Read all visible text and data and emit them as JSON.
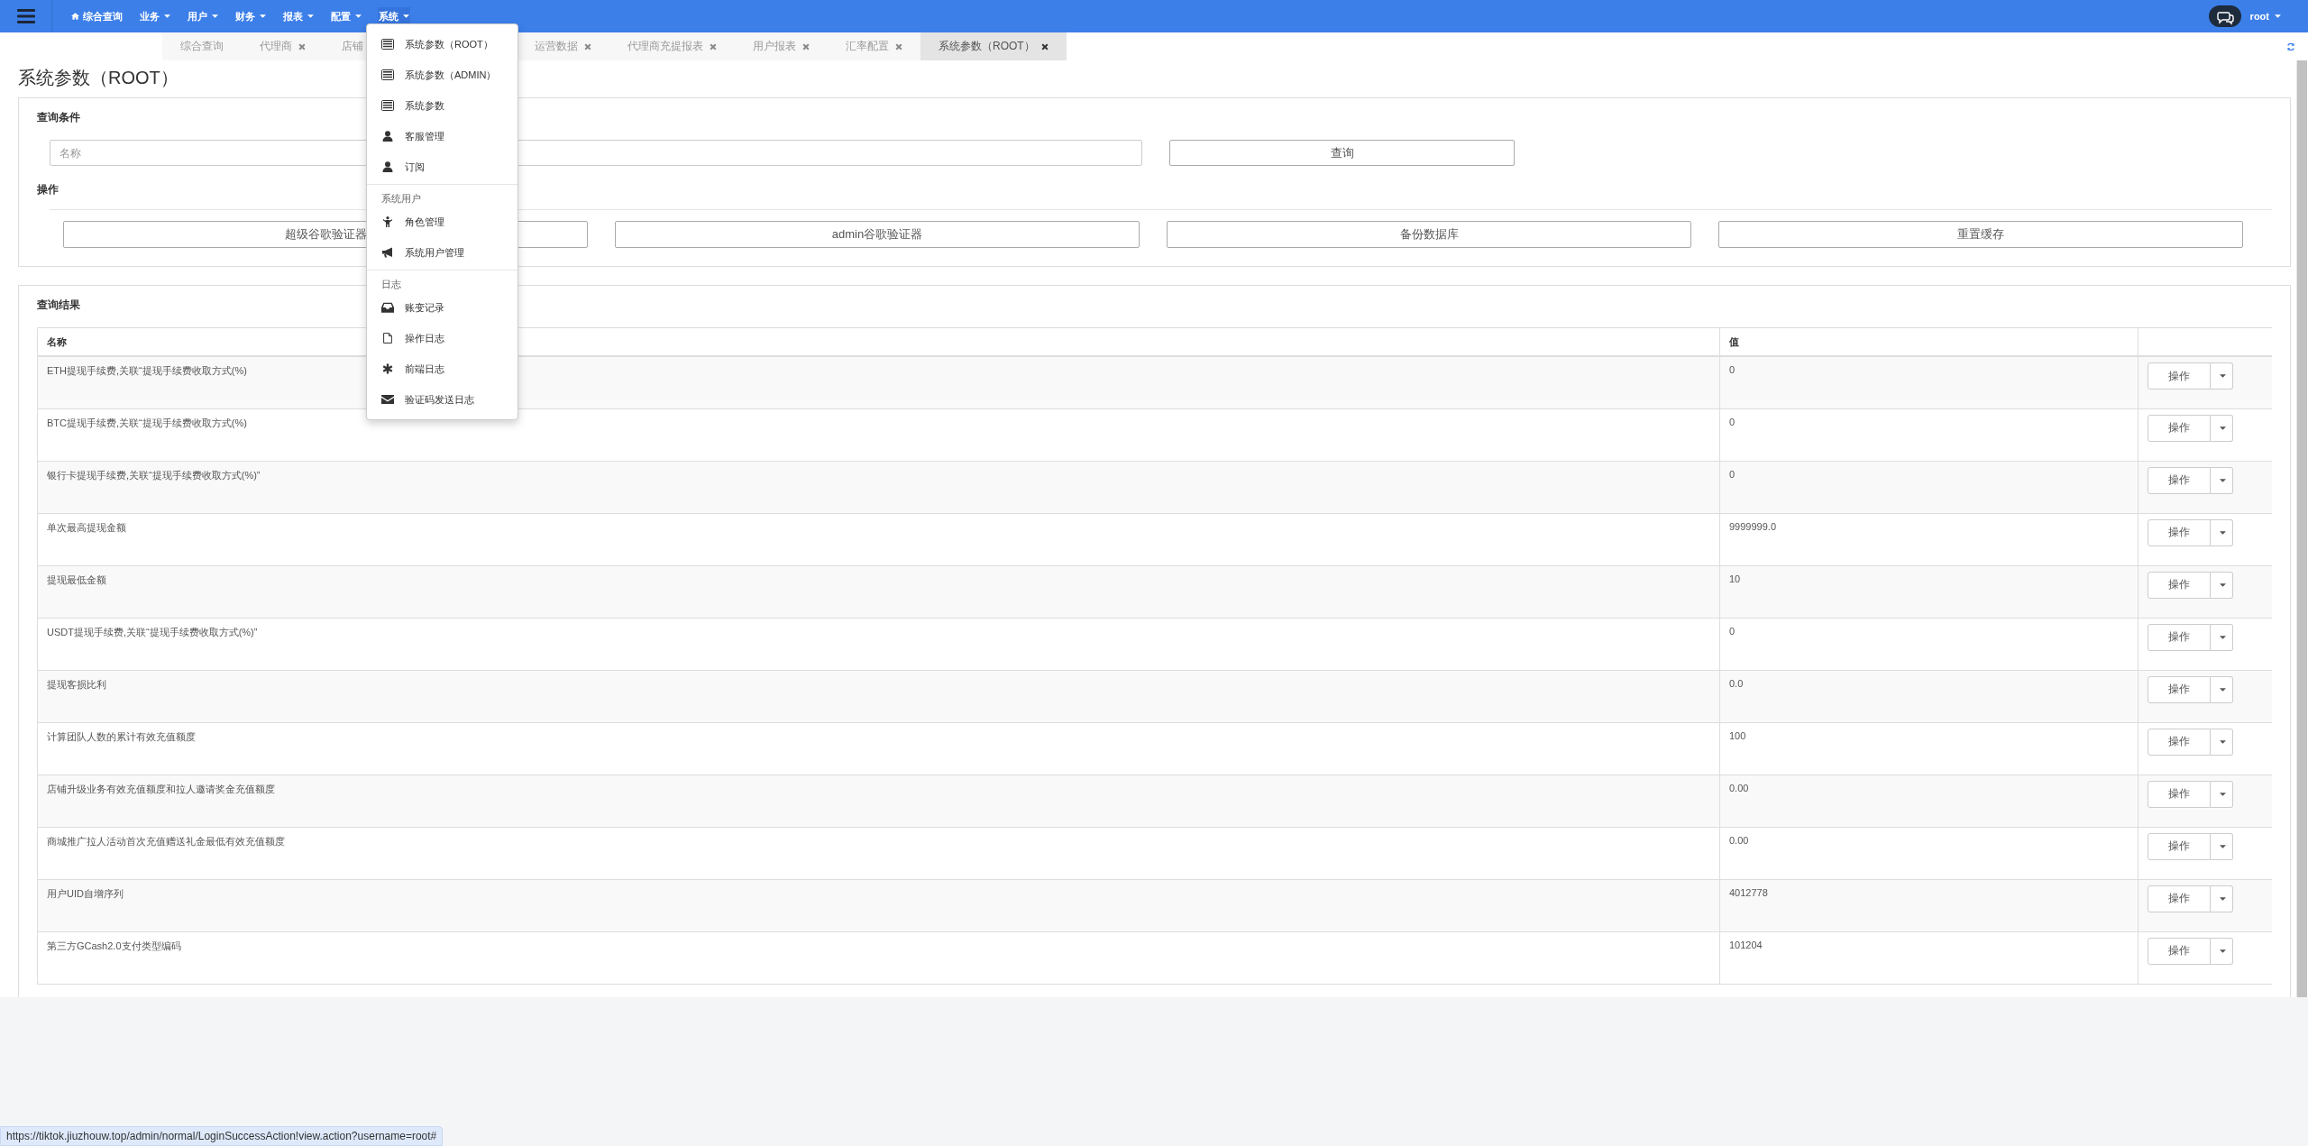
{
  "navbar": {
    "items": [
      {
        "kind": "home",
        "label": "综合查询",
        "open": false
      },
      {
        "kind": "dropdown",
        "label": "业务",
        "open": false
      },
      {
        "kind": "dropdown",
        "label": "用户",
        "open": false
      },
      {
        "kind": "dropdown",
        "label": "财务",
        "open": false
      },
      {
        "kind": "dropdown",
        "label": "报表",
        "open": false
      },
      {
        "kind": "dropdown",
        "label": "配置",
        "open": false
      },
      {
        "kind": "dropdown",
        "label": "系统",
        "open": true
      }
    ],
    "user": "root"
  },
  "tabs": [
    {
      "label": "综合查询",
      "closable": false,
      "selected": false
    },
    {
      "label": "代理商",
      "closable": true,
      "selected": false
    },
    {
      "label": "店铺",
      "closable": false,
      "selected": false
    },
    {
      "label": "运营数据",
      "closable": true,
      "selected": false
    },
    {
      "label": "代理商充提报表",
      "closable": true,
      "selected": false
    },
    {
      "label": "用户报表",
      "closable": true,
      "selected": false
    },
    {
      "label": "汇率配置",
      "closable": true,
      "selected": false
    },
    {
      "label": "系统参数（ROOT）",
      "closable": true,
      "selected": true
    }
  ],
  "page_title": "系统参数（ROOT）",
  "query_panel": {
    "title": "查询条件",
    "name_field": {
      "placeholder": "名称"
    },
    "search_button": "查询",
    "actions_title": "操作",
    "action_buttons": [
      "超级谷歌验证器",
      "admin谷歌验证器",
      "备份数据库",
      "重置缓存"
    ]
  },
  "results_panel": {
    "title": "查询结果",
    "columns": [
      "名称",
      "值"
    ],
    "rows": [
      {
        "name": "ETH提现手续费,关联“提现手续费收取方式(%)",
        "value": "0",
        "action": "操作"
      },
      {
        "name": "BTC提现手续费,关联“提现手续费收取方式(%)",
        "value": "0",
        "action": "操作"
      },
      {
        "name": "银行卡提现手续费,关联“提现手续费收取方式(%)”",
        "value": "0",
        "action": "操作"
      },
      {
        "name": "单次最高提现金额",
        "value": "9999999.0",
        "action": "操作"
      },
      {
        "name": "提现最低金额",
        "value": "10",
        "action": "操作"
      },
      {
        "name": "USDT提现手续费,关联“提现手续费收取方式(%)”",
        "value": "0",
        "action": "操作"
      },
      {
        "name": "提现客损比利",
        "value": "0.0",
        "action": "操作"
      },
      {
        "name": "计算团队人数的累计有效充值额度",
        "value": "100",
        "action": "操作"
      },
      {
        "name": "店铺升级业务有效充值额度和拉人邀请奖金充值额度",
        "value": "0.00",
        "action": "操作"
      },
      {
        "name": "商城推广拉人活动首次充值赠送礼金最低有效充值额度",
        "value": "0.00",
        "action": "操作"
      },
      {
        "name": "用户UID自增序列",
        "value": "4012778",
        "action": "操作"
      },
      {
        "name": "第三方GCash2.0支付类型编码",
        "value": "101204",
        "action": "操作"
      }
    ]
  },
  "dropdown_menu": {
    "sections": [
      {
        "items": [
          "系统参数（ROOT）",
          "系统参数（ADMIN）",
          "系统参数",
          "客服管理",
          "订阅"
        ]
      },
      {
        "header": "系统用户",
        "items": [
          "角色管理",
          "系统用户管理"
        ]
      },
      {
        "header": "日志",
        "items": [
          "账变记录",
          "操作日志",
          "前端日志",
          "验证码发送日志"
        ]
      }
    ]
  },
  "status_bar": {
    "url": "https://tiktok.jiuzhouw.top/admin/normal/LoginSuccessAction!view.action?username=root#"
  }
}
